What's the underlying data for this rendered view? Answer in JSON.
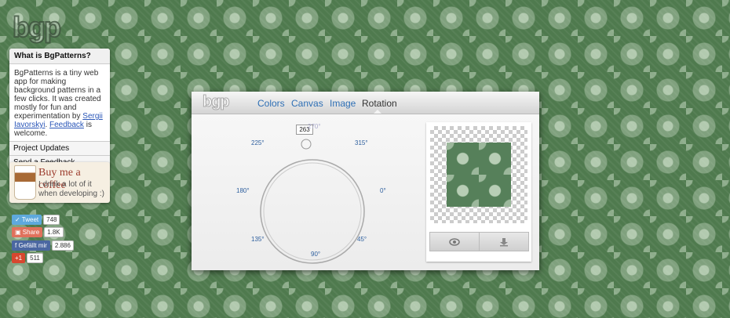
{
  "logo": "bgp",
  "about": {
    "title": "What is BgPatterns?",
    "text": "BgPatterns is a tiny web app for making background patterns in a few clicks. It was created mostly for fun and experimentation by ",
    "author": "Sergii Iavorskyi",
    "period": ".",
    "feedback_link": "Feedback",
    "feedback_tail": " is welcome.",
    "project_updates": "Project Updates",
    "send_feedback": "Send a Feedback"
  },
  "coffee": {
    "title": "Buy me a coffee",
    "subtitle": "I drink a lot of it when developing :)"
  },
  "social": {
    "tweet": "Tweet",
    "tweet_count": "748",
    "share": "Share",
    "share_count": "1.8K",
    "like": "Gefällt mir",
    "like_count": "2.886",
    "gplus": "+1",
    "gplus_count": "511"
  },
  "toolbar": {
    "logo": "bgp",
    "tabs": [
      "Colors",
      "Canvas",
      "Image",
      "Rotation"
    ],
    "active_tab": "Rotation"
  },
  "rotation": {
    "value": "263",
    "labels": {
      "d270": "270°",
      "d315": "315°",
      "d0": "0°",
      "d45": "45°",
      "d90": "90°",
      "d135": "135°",
      "d180": "180°",
      "d225": "225°"
    }
  },
  "icons": {
    "preview": "eye-icon",
    "download": "download-icon"
  }
}
